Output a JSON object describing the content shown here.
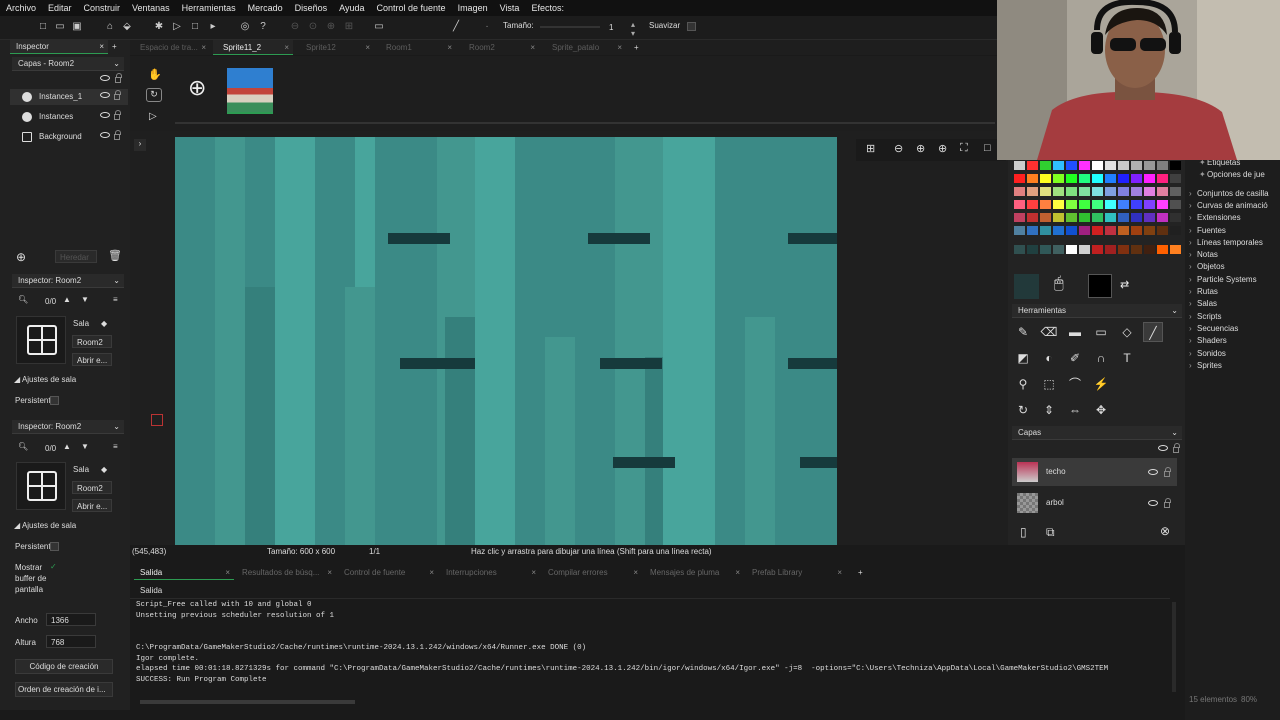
{
  "menu": [
    "Archivo",
    "Editar",
    "Construir",
    "Ventanas",
    "Herramientas",
    "Mercado",
    "Diseños",
    "Ayuda",
    "Control de fuente",
    "Imagen",
    "Vista",
    "Efectos:"
  ],
  "toolbar": {
    "size_label": "Tamaño:",
    "size_value": "1",
    "smooth_label": "Suavizar"
  },
  "doc_tabs": [
    {
      "label": "Espacio de tra...",
      "active": false
    },
    {
      "label": "Sprite11_2",
      "active": true
    },
    {
      "label": "Sprite12",
      "active": false
    },
    {
      "label": "Room1",
      "active": false
    },
    {
      "label": "Room2",
      "active": false
    },
    {
      "label": "Sprite_patalo",
      "active": false
    }
  ],
  "inspector": {
    "title": "Inspector",
    "layers_header": "Capas - Room2",
    "layers": [
      {
        "label": "Instances_1",
        "selected": true,
        "icon": "instance-layer-icon"
      },
      {
        "label": "Instances",
        "selected": false,
        "icon": "instance-layer-icon"
      },
      {
        "label": "Background",
        "selected": false,
        "icon": "background-layer-icon"
      }
    ],
    "inherit_label": "Heredar"
  },
  "room_inspector_1": {
    "title": "Inspector: Room2",
    "search_count": "0/0",
    "sala_label": "Sala",
    "room_name": "Room2",
    "open_label": "Abrir e...",
    "settings_label": "Ajustes de sala",
    "persist_label": "Persistent"
  },
  "room_inspector_2": {
    "title": "Inspector: Room2",
    "search_count": "0/0",
    "sala_label": "Sala",
    "room_name": "Room2",
    "open_label": "Abrir e...",
    "settings_label": "Ajustes de sala",
    "persist_label": "Persistent",
    "show_buffer_label": "Mostrar buffer de pantalla",
    "width_label": "Ancho",
    "width_value": "1366",
    "height_label": "Altura",
    "height_value": "768",
    "creation_code": "Código de creación",
    "creation_order": "Orden de creación de i..."
  },
  "status": {
    "coords": "(545,483)",
    "size": "Tamaño: 600 x 600",
    "frame": "1/1",
    "hint": "Haz clic y arrastra para dibujar una línea (Shift para una línea recta)"
  },
  "right_panel": {
    "tools_header": "Herramientas",
    "layers_header": "Capas",
    "layers": [
      {
        "label": "techo",
        "selected": true
      },
      {
        "label": "arbol",
        "selected": false
      }
    ]
  },
  "assets": [
    {
      "label": "Etiquetas",
      "indent": true
    },
    {
      "label": "Opciones de jue",
      "indent": true
    },
    {
      "label": "Conjuntos de casilla",
      "indent": false
    },
    {
      "label": "Curvas de animació",
      "indent": false
    },
    {
      "label": "Extensiones",
      "indent": false
    },
    {
      "label": "Fuentes",
      "indent": false
    },
    {
      "label": "Líneas temporales",
      "indent": false
    },
    {
      "label": "Notas",
      "indent": false
    },
    {
      "label": "Objetos",
      "indent": false
    },
    {
      "label": "Particle Systems",
      "indent": false
    },
    {
      "label": "Rutas",
      "indent": false
    },
    {
      "label": "Salas",
      "indent": false
    },
    {
      "label": "Scripts",
      "indent": false
    },
    {
      "label": "Secuencias",
      "indent": false
    },
    {
      "label": "Shaders",
      "indent": false
    },
    {
      "label": "Sonidos",
      "indent": false
    },
    {
      "label": "Sprites",
      "indent": false
    }
  ],
  "assets_footer": "15 elementos",
  "zoom_footer": "80%",
  "output": {
    "tabs": [
      "Salida",
      "Resultados de búsq...",
      "Control de fuente",
      "Interrupciones",
      "Compilar errores",
      "Mensajes de pluma",
      "Prefab Library"
    ],
    "section": "Salida",
    "lines": [
      "Script_Free called with 10 and global 0",
      "Unsetting previous scheduler resolution of 1",
      "",
      "",
      "C:\\ProgramData/GameMakerStudio2/Cache/runtimes\\runtime-2024.13.1.242/windows/x64/Runner.exe DONE (0)",
      "Igor complete.",
      "elapsed time 00:01:18.8271329s for command \"C:\\ProgramData/GameMakerStudio2/Cache/runtimes\\runtime-2024.13.1.242/bin/igor/windows/x64/Igor.exe\" -j=8  -options=\"C:\\Users\\Techniza\\AppData\\Local\\GameMakerStudio2\\GMS2TEM",
      "SUCCESS: Run Program Complete"
    ]
  },
  "colors": {
    "accent": "#2d9b52",
    "canvas": "#3b8a86",
    "canvas_light": "#48a59c",
    "canvas_dark": "#163a3c"
  }
}
